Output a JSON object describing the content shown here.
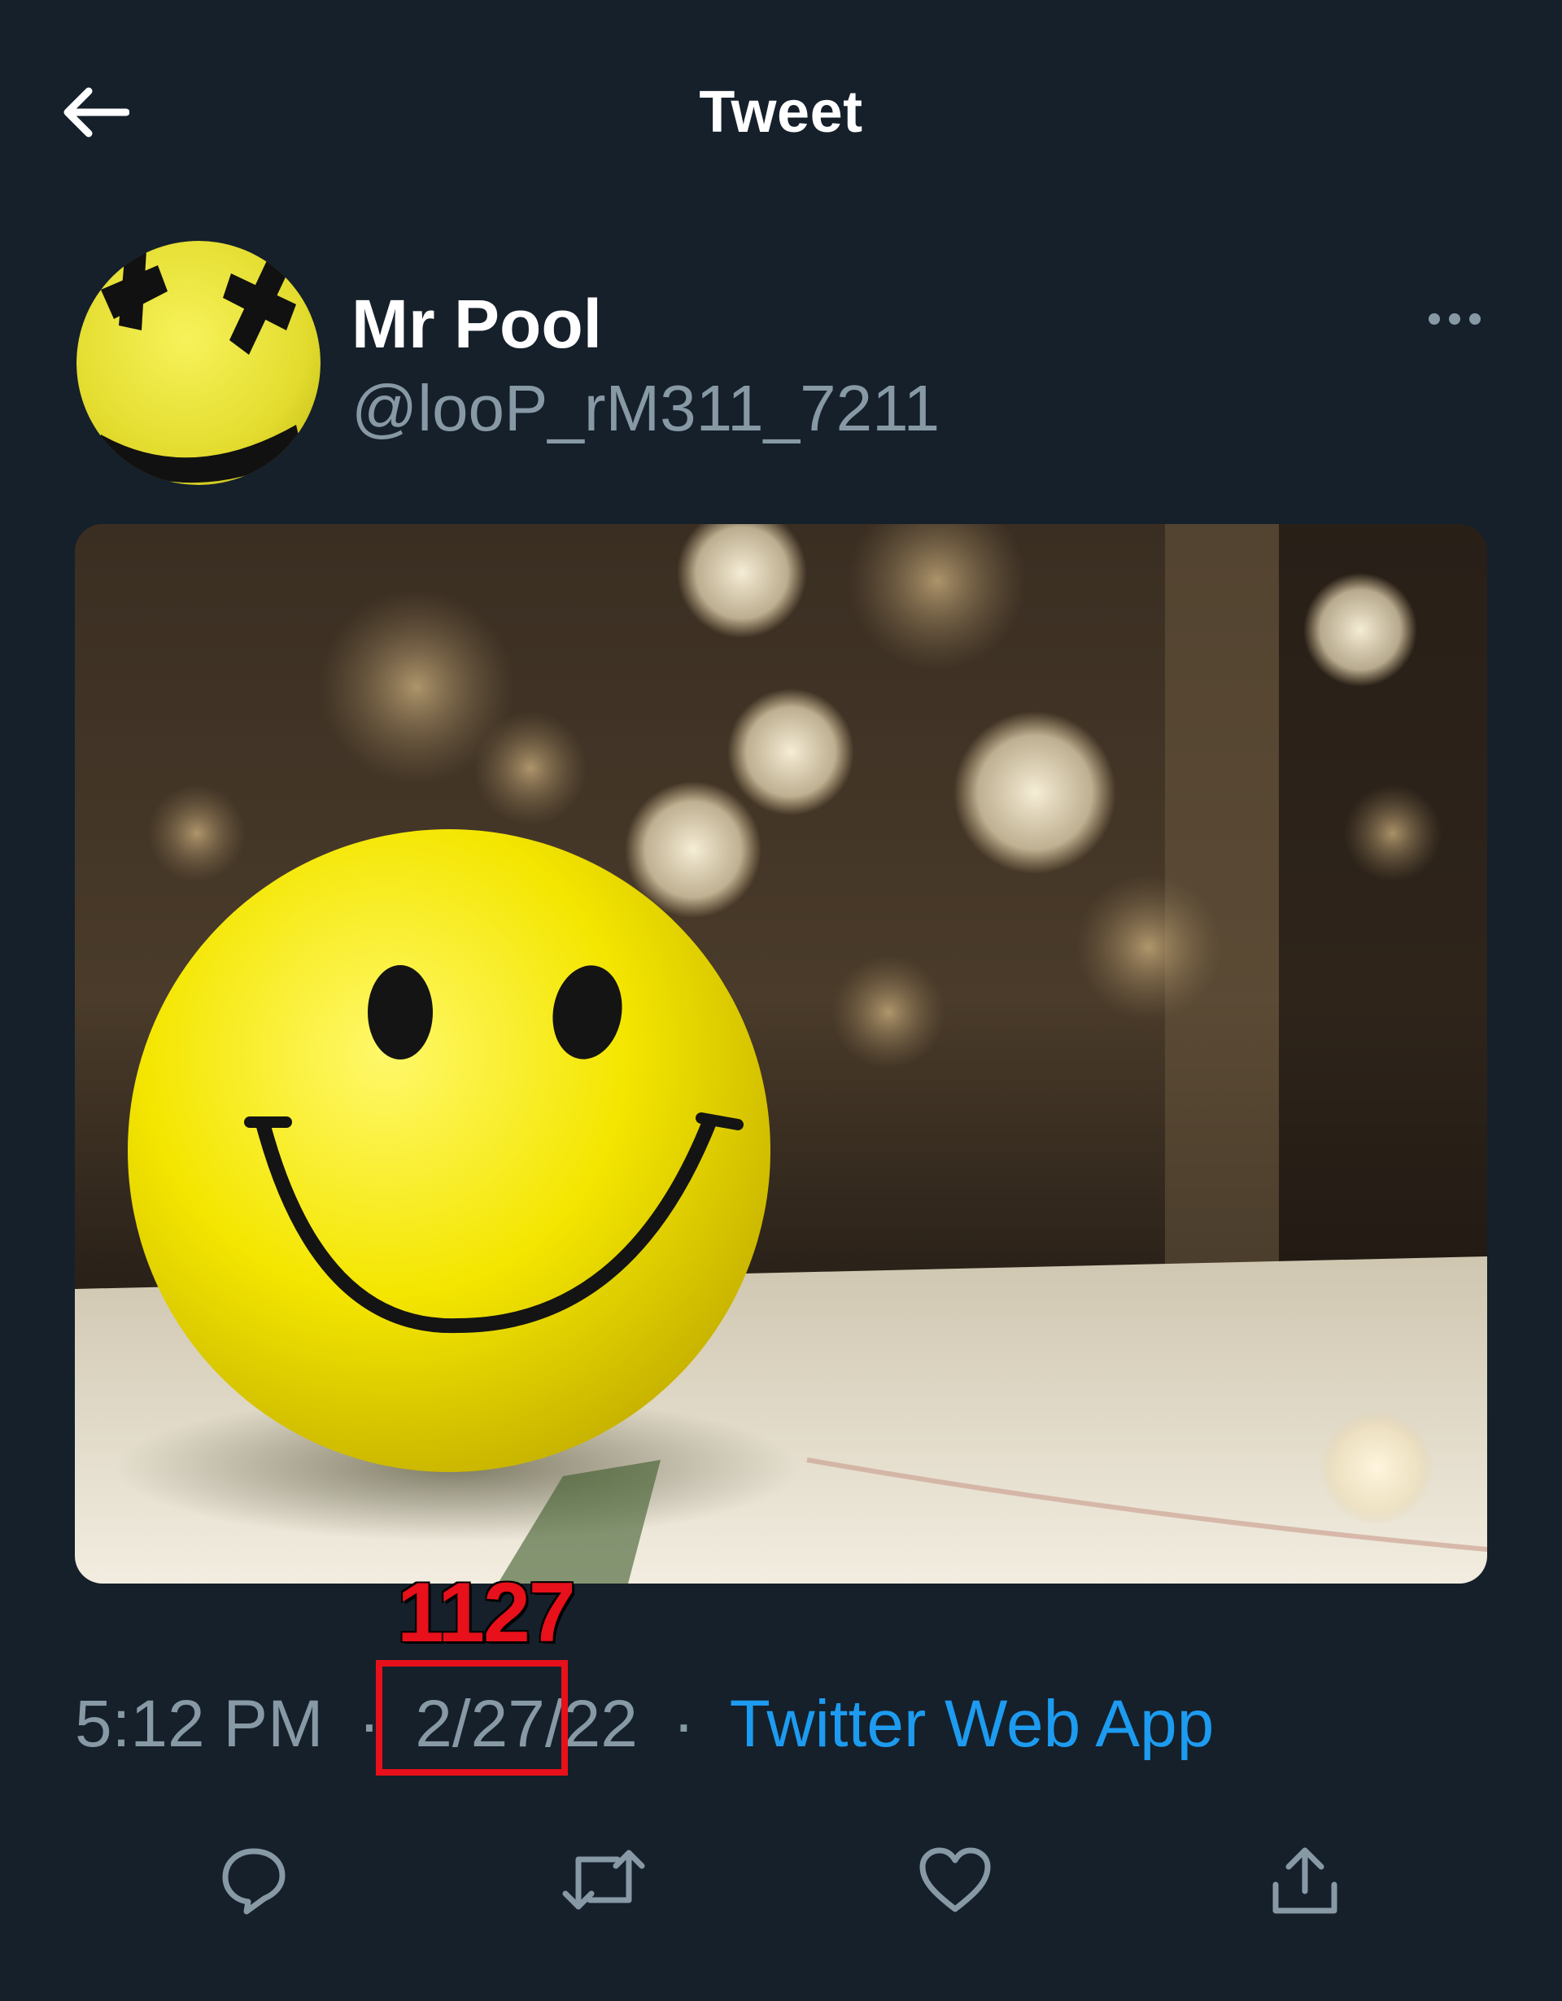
{
  "header": {
    "title": "Tweet",
    "back_icon": "arrow-left-icon"
  },
  "tweet": {
    "author": {
      "display_name": "Mr Pool",
      "handle": "@looP_rM311_7211",
      "avatar_icon": "smiley-face-avatar"
    },
    "more_icon": "ellipsis-icon",
    "media": {
      "subject": "yellow smiley face ball on table with bokeh lights"
    },
    "meta": {
      "time": "5:12 PM",
      "separator": "·",
      "date": "2/27/22",
      "source": "Twitter Web App"
    },
    "actions": {
      "reply_icon": "reply-icon",
      "retweet_icon": "retweet-icon",
      "like_icon": "heart-icon",
      "share_icon": "share-icon"
    }
  },
  "annotation": {
    "number": "1127",
    "color": "#e8101b"
  },
  "colors": {
    "background": "#15202b",
    "primary_text": "#ffffff",
    "secondary_text": "#8899a6",
    "link": "#1d9bf0",
    "smiley_yellow": "#f4e600"
  }
}
